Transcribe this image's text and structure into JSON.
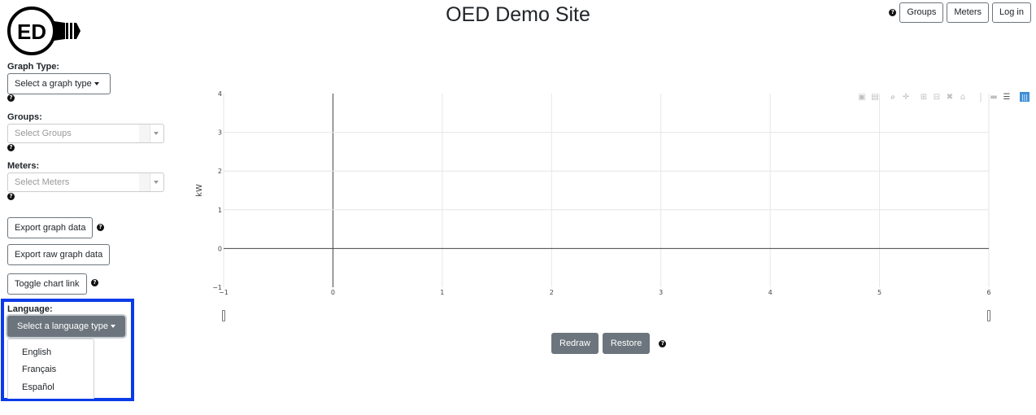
{
  "header": {
    "title": "OED Demo Site",
    "logo_text": "ED",
    "help_icon": "question-circle-icon",
    "nav": [
      {
        "label": "Groups"
      },
      {
        "label": "Meters"
      },
      {
        "label": "Log in"
      }
    ]
  },
  "sidebar": {
    "graph_type": {
      "label": "Graph Type:",
      "button": "Select a graph type"
    },
    "groups": {
      "label": "Groups:",
      "placeholder": "Select Groups"
    },
    "meters": {
      "label": "Meters:",
      "placeholder": "Select Meters"
    },
    "export_graph": "Export graph data",
    "export_raw": "Export raw graph data",
    "toggle_link": "Toggle chart link",
    "language": {
      "label": "Language:",
      "button": "Select a language type",
      "options": [
        "English",
        "Français",
        "Español"
      ],
      "highlight_color": "#0b3be8"
    }
  },
  "chart_controls": {
    "redraw": "Redraw",
    "restore": "Restore"
  },
  "modebar": {
    "icons": [
      "camera-icon",
      "save-icon",
      "zoom-icon",
      "pan-icon",
      "zoom-in-icon",
      "zoom-out-icon",
      "autoscale-icon",
      "home-icon",
      "spike-lines-icon",
      "hover-closest-icon",
      "hover-compare-icon",
      "plotly-logo-icon"
    ],
    "logo_color": "#3f8fd6"
  },
  "chart_data": {
    "type": "line",
    "title": "",
    "xlabel": "",
    "ylabel": "kW",
    "xlim": [
      -1,
      6
    ],
    "ylim": [
      -1,
      4
    ],
    "x_ticks": [
      "−1",
      "0",
      "1",
      "2",
      "3",
      "4",
      "5",
      "6"
    ],
    "y_ticks": [
      "−1",
      "0",
      "1",
      "2",
      "3",
      "4"
    ],
    "grid": true,
    "series": []
  }
}
